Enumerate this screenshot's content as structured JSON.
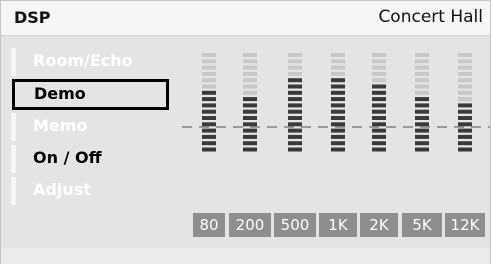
{
  "header": {
    "title": "DSP",
    "preset": "Concert Hall"
  },
  "menu": [
    {
      "label": "Room/Echo",
      "style": "light"
    },
    {
      "label": "Demo",
      "style": "selected"
    },
    {
      "label": "Memo",
      "style": "light"
    },
    {
      "label": "On / Off",
      "style": "dark"
    },
    {
      "label": "Adjust",
      "style": "light"
    }
  ],
  "equalizer": {
    "segments_total": 16,
    "bands": [
      {
        "label": "80",
        "active_segments": 10
      },
      {
        "label": "200",
        "active_segments": 9
      },
      {
        "label": "500",
        "active_segments": 12
      },
      {
        "label": "1K",
        "active_segments": 12
      },
      {
        "label": "2K",
        "active_segments": 11
      },
      {
        "label": "5K",
        "active_segments": 9
      },
      {
        "label": "12K",
        "active_segments": 8
      }
    ],
    "colors": {
      "active": "#3a3a3a",
      "inactive": "#c8c8c8",
      "label_bg": "#8e8e8e"
    }
  }
}
